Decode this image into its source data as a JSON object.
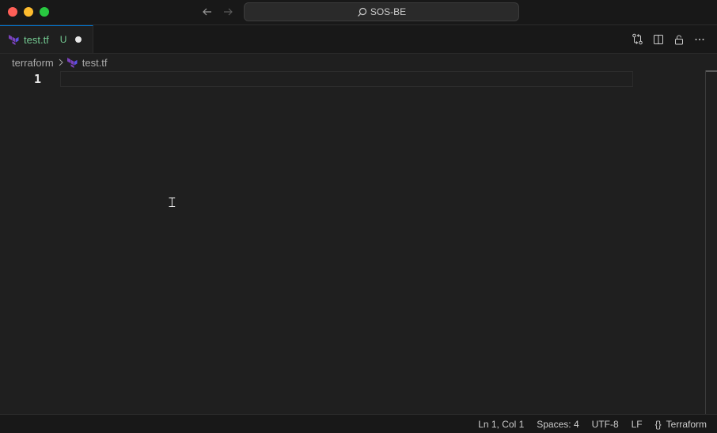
{
  "titlebar": {
    "search_text": "SOS-BE",
    "icons": [
      "back-arrow-icon",
      "forward-arrow-icon",
      "search-icon"
    ]
  },
  "tab": {
    "label": "test.tf",
    "status": "U",
    "icon": "terraform-icon",
    "label_color": "#73c991"
  },
  "editor_actions": [
    "git-compare-icon",
    "split-editor-icon",
    "lock-icon",
    "more-actions-icon"
  ],
  "breadcrumb": {
    "folder": "terraform",
    "file": "test.tf"
  },
  "editor": {
    "line_number": "1",
    "cursor_glyph": "𝙸"
  },
  "statusbar": {
    "position": "Ln 1, Col 1",
    "spaces": "Spaces: 4",
    "encoding": "UTF-8",
    "eol": "LF",
    "language_icon": "{}",
    "language": "Terraform"
  },
  "colors": {
    "accent": "#0078d4",
    "untracked": "#73c991",
    "terraform": "#7b42bc"
  }
}
